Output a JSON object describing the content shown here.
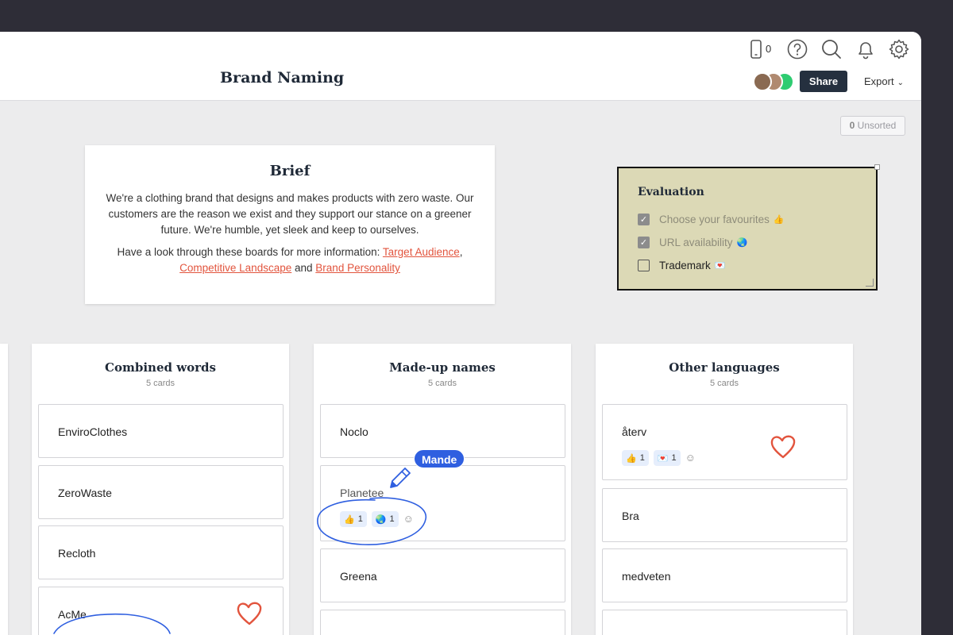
{
  "header": {
    "title": "Brand Naming",
    "device_count": "0",
    "share_label": "Share",
    "export_label": "Export"
  },
  "icons": [
    "device-icon",
    "help-icon",
    "search-icon",
    "bell-icon",
    "gear-icon",
    "chevron-down-icon",
    "smile-add-icon",
    "heart-icon",
    "pencil-icon"
  ],
  "unsorted": {
    "count": "0",
    "label": "Unsorted"
  },
  "brief": {
    "title": "Brief",
    "body": "We're a clothing brand that designs and makes products with zero waste. Our customers are the reason we exist and they support our stance on a greener future. We're humble, yet sleek and keep to ourselves.",
    "links_intro": "Have a look through these boards for more information:",
    "link1": "Target Audience",
    "link2": "Competitive Landscape",
    "and": "and",
    "link3": "Brand Personality"
  },
  "evaluation": {
    "title": "Evaluation",
    "items": [
      {
        "label": "Choose your favourites",
        "emoji": "👍",
        "checked": true
      },
      {
        "label": "URL availability",
        "emoji": "🌏",
        "checked": true
      },
      {
        "label": "Trademark",
        "emoji": "💌",
        "checked": false
      }
    ]
  },
  "columns": [
    {
      "title": "Combined words",
      "count": "5 cards",
      "cards": [
        {
          "text": "EnviroClothes"
        },
        {
          "text": "ZeroWaste"
        },
        {
          "text": "Recloth"
        },
        {
          "text": "AcMe"
        }
      ]
    },
    {
      "title": "Made-up names",
      "count": "5 cards",
      "cards": [
        {
          "text": "Noclo"
        },
        {
          "text": "Planetee",
          "reactions": [
            {
              "emoji": "👍",
              "count": "1"
            },
            {
              "emoji": "🌏",
              "count": "1"
            }
          ]
        },
        {
          "text": "Greena"
        },
        {
          "text": ""
        }
      ]
    },
    {
      "title": "Other languages",
      "count": "5 cards",
      "cards": [
        {
          "text": "återv",
          "reactions": [
            {
              "emoji": "👍",
              "count": "1"
            },
            {
              "emoji": "💌",
              "count": "1"
            }
          ]
        },
        {
          "text": "Bra"
        },
        {
          "text": "medveten"
        },
        {
          "text": ""
        }
      ]
    }
  ],
  "cursor": {
    "name": "Mande"
  },
  "colors": {
    "accent": "#2f5fe0",
    "link": "#e2543d",
    "share_bg": "#25303f",
    "note_bg": "#dcd9b6",
    "heart": "#e2543d"
  }
}
